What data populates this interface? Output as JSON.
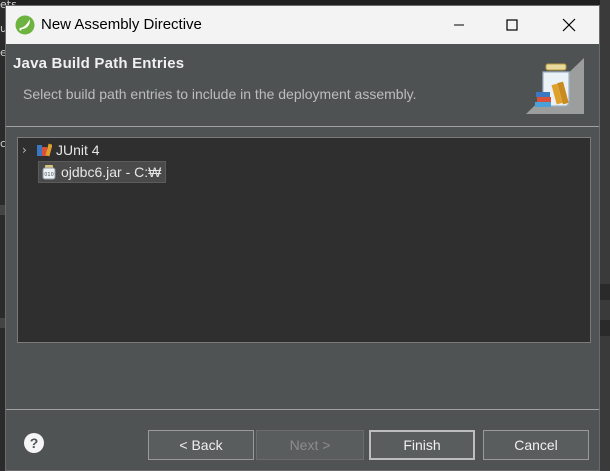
{
  "background": {
    "left_fragments": [
      "ets",
      "u",
      "e",
      "c"
    ]
  },
  "dialog": {
    "title": "New Assembly Directive",
    "page_title": "Java Build Path Entries",
    "page_description": "Select build path entries to include in the deployment assembly.",
    "tree": {
      "items": [
        {
          "label": "JUnit 4",
          "icon": "library-icon",
          "expandable": true,
          "selected": false
        },
        {
          "label": "ojdbc6.jar - C:₩",
          "icon": "jar-icon",
          "expandable": false,
          "selected": true
        }
      ]
    },
    "buttons": {
      "back": "< Back",
      "next": "Next >",
      "finish": "Finish",
      "cancel": "Cancel"
    },
    "help": "?"
  },
  "colors": {
    "dialog_bg": "#505354",
    "titlebar_bg": "#f3f3f3",
    "tree_bg": "#2f2f2f"
  }
}
